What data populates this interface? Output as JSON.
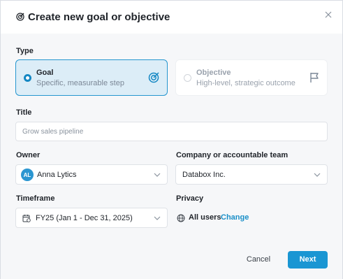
{
  "modal": {
    "title": "Create new goal or objective",
    "colors": {
      "accent": "#1a96d3",
      "selected_bg": "#dcedf7",
      "link": "#1a8fc8"
    }
  },
  "type_section": {
    "label": "Type",
    "options": [
      {
        "title": "Goal",
        "subtitle": "Specific, measurable step",
        "selected": true,
        "icon": "target-icon"
      },
      {
        "title": "Objective",
        "subtitle": "High-level, strategic outcome",
        "selected": false,
        "icon": "flag-icon"
      }
    ]
  },
  "title_field": {
    "label": "Title",
    "placeholder": "Grow sales pipeline"
  },
  "owner_field": {
    "label": "Owner",
    "avatar_initials": "AL",
    "value": "Anna Lytics"
  },
  "company_field": {
    "label": "Company or accountable team",
    "value": "Databox Inc."
  },
  "timeframe_field": {
    "label": "Timeframe",
    "value": "FY25 (Jan 1 - Dec 31, 2025)"
  },
  "privacy_field": {
    "label": "Privacy",
    "value": "All users",
    "action": "Change"
  },
  "footer": {
    "cancel_label": "Cancel",
    "next_label": "Next"
  }
}
